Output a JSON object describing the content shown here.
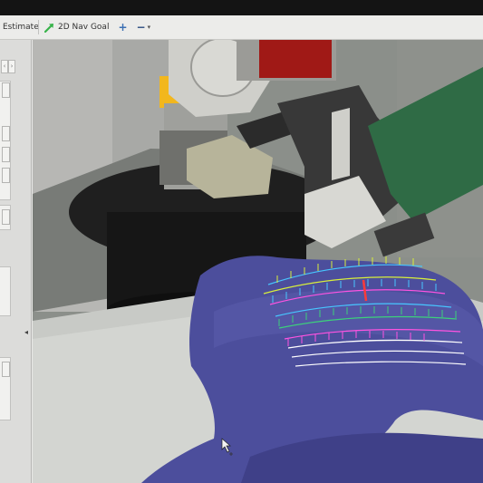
{
  "toolbar": {
    "estimate_label": "Estimate",
    "nav_goal_label": "2D Nav Goal",
    "add_label": "+",
    "remove_label": "−",
    "remove_caret": "▾"
  },
  "left_panel": {
    "scroll_left": "‹",
    "scroll_right": "›",
    "collapse_arrow": "◂"
  },
  "viewport": {
    "background_color": "#8a8f88",
    "floor_color": "#c7c9c5",
    "scan_color": "#4b4c9b",
    "gripper_color": "#3a3a3a",
    "grinder_color": "#2f6b45",
    "robot_link_color": "#cfcfca",
    "robot_base_color": "#f0b81f",
    "path_colors": [
      "#47c6ff",
      "#ff53e1",
      "#d8ef3b",
      "#3dd07b",
      "#ffffff",
      "#ff3a3a"
    ]
  }
}
